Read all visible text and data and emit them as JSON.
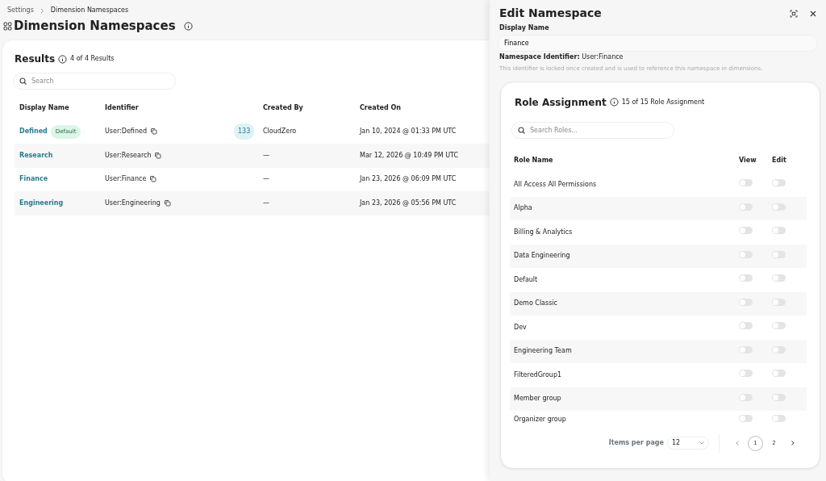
{
  "breadcrumb": [
    {
      "label": "Settings",
      "current": false
    },
    {
      "label": "Dimension Namespaces",
      "current": true
    }
  ],
  "page_title": "Dimension Namespaces",
  "results": {
    "title": "Results",
    "count": "4 of 4 Results",
    "search": {
      "placeholder": "Search"
    }
  },
  "table": {
    "columns": [
      "Display Name",
      "Identifier",
      "Created By",
      "Created On"
    ],
    "rows": [
      {
        "name": "Defined",
        "badge": "Default",
        "identifier": "User:Defined",
        "count": "133",
        "created_by": "CloudZero",
        "created_on": "Jan 10, 2024 @ 01:33 PM UTC"
      },
      {
        "name": "Research",
        "identifier": "User:Research",
        "created_by": "—",
        "created_on": "Mar 12, 2026 @ 10:49 PM UTC"
      },
      {
        "name": "Finance",
        "identifier": "User:Finance",
        "created_by": "—",
        "created_on": "Jan 23, 2026 @ 06:09 PM UTC"
      },
      {
        "name": "Engineering",
        "identifier": "User:Engineering",
        "created_by": "—",
        "created_on": "Jan 23, 2026 @ 05:56 PM UTC"
      }
    ]
  },
  "panel": {
    "title": "Edit Namespace",
    "display_name_label": "Display Name",
    "display_name_value": "Finance",
    "identifier_label": "Namespace Identifier:",
    "identifier_value": "User:Finance",
    "help": "This identifier is locked once created and is used to reference this namespace in dimensions.",
    "roles": {
      "title": "Role Assignment",
      "count": "15 of 15 Role Assignment",
      "search": {
        "placeholder": "Search Roles..."
      },
      "columns": [
        "Role Name",
        "View",
        "Edit"
      ],
      "rows": [
        {
          "name": "All Access All Permissions",
          "view": false,
          "edit": false
        },
        {
          "name": "Alpha",
          "view": false,
          "edit": false
        },
        {
          "name": "Billing & Analytics",
          "view": false,
          "edit": false
        },
        {
          "name": "Data Engineering",
          "view": false,
          "edit": false
        },
        {
          "name": "Default",
          "view": false,
          "edit": false
        },
        {
          "name": "Demo Classic",
          "view": false,
          "edit": false
        },
        {
          "name": "Dev",
          "view": false,
          "edit": false
        },
        {
          "name": "Engineering Team",
          "view": false,
          "edit": false
        },
        {
          "name": "FilteredGroup1",
          "view": false,
          "edit": false
        },
        {
          "name": "Member group",
          "view": false,
          "edit": false
        },
        {
          "name": "Organizer group",
          "view": false,
          "edit": false
        }
      ],
      "items_per_page_label": "Items per page",
      "items_per_page": "12",
      "pages": [
        {
          "label": "1",
          "selected": true
        },
        {
          "label": "2",
          "selected": false
        }
      ]
    }
  }
}
